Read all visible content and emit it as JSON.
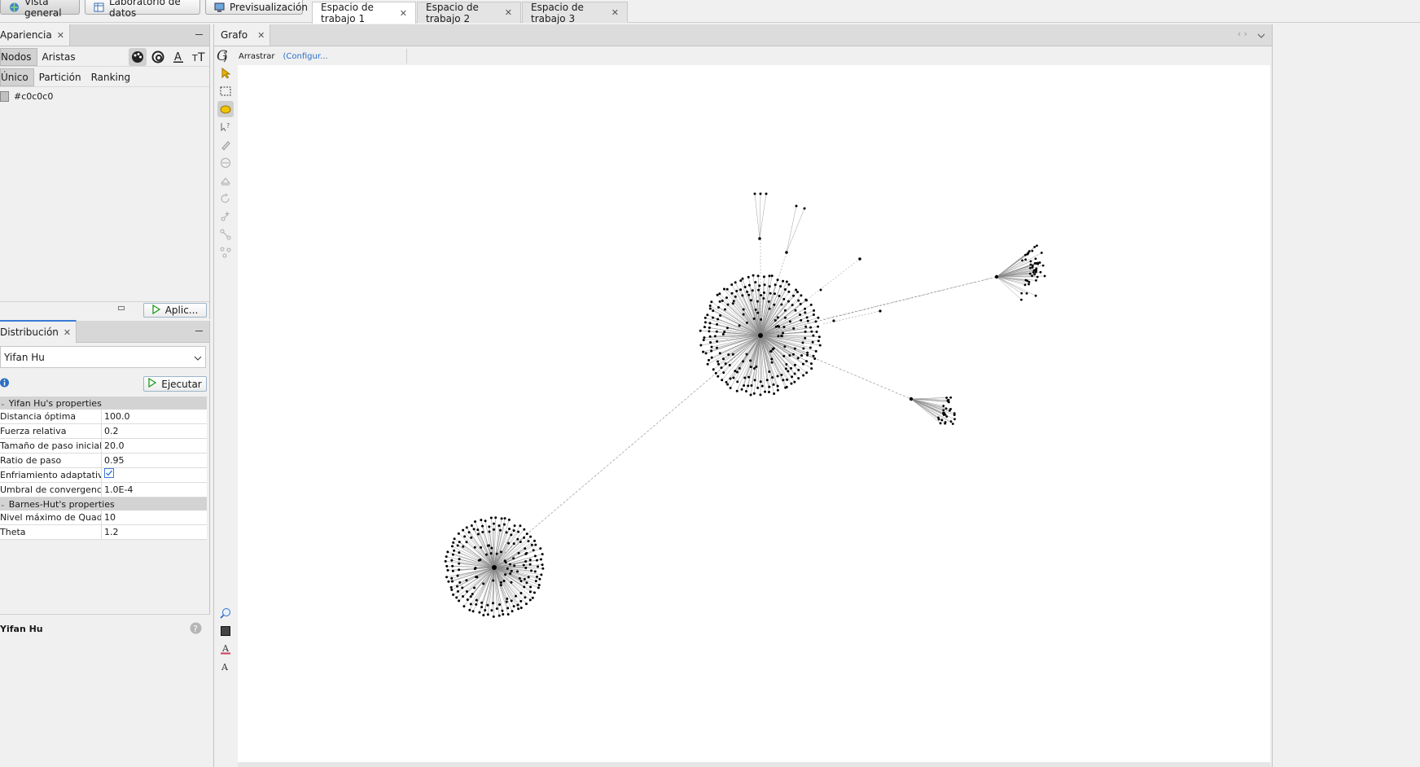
{
  "perspectives": [
    {
      "label": "Vista general",
      "active": true,
      "icon": "globe-icon"
    },
    {
      "label": "Laboratorio de datos",
      "active": false,
      "icon": "table-icon"
    },
    {
      "label": "Previsualización",
      "active": false,
      "icon": "monitor-icon"
    }
  ],
  "workspaces": [
    {
      "label": "Espacio de trabajo 1",
      "active": true
    },
    {
      "label": "Espacio de trabajo 2",
      "active": false
    },
    {
      "label": "Espacio de trabajo 3",
      "active": false
    }
  ],
  "appearance": {
    "tab_label": "Apariencia",
    "subtabs": [
      "Nodos",
      "Aristas"
    ],
    "modes": [
      "Único",
      "Partición",
      "Ranking"
    ],
    "color_value": "#c0c0c0",
    "apply_label": "Aplic..."
  },
  "layout": {
    "tab_label": "Distribución",
    "algorithm": "Yifan Hu",
    "run_label": "Ejecutar",
    "section1": "Yifan Hu's properties",
    "props1": [
      {
        "k": "Distancia óptima",
        "v": "100.0"
      },
      {
        "k": "Fuerza relativa",
        "v": "0.2"
      },
      {
        "k": "Tamaño de paso inicial",
        "v": "20.0"
      },
      {
        "k": "Ratio de paso",
        "v": "0.95"
      },
      {
        "k": "Enfriamiento adaptativo",
        "v": "",
        "checked": true
      },
      {
        "k": "Umbral de convergencia",
        "v": "1.0E-4"
      }
    ],
    "section2": "Barnes-Hut's properties",
    "props2": [
      {
        "k": "Nivel máximo de Quadtree",
        "v": "10"
      },
      {
        "k": "Theta",
        "v": "1.2"
      }
    ],
    "footer_title": "Yifan Hu"
  },
  "graph": {
    "tab_label": "Grafo",
    "mode_label": "Arrastrar",
    "config_label": "(Configur...",
    "colors": {
      "node": "#000000",
      "edge": "#888888",
      "canvas": "#ffffff"
    }
  }
}
